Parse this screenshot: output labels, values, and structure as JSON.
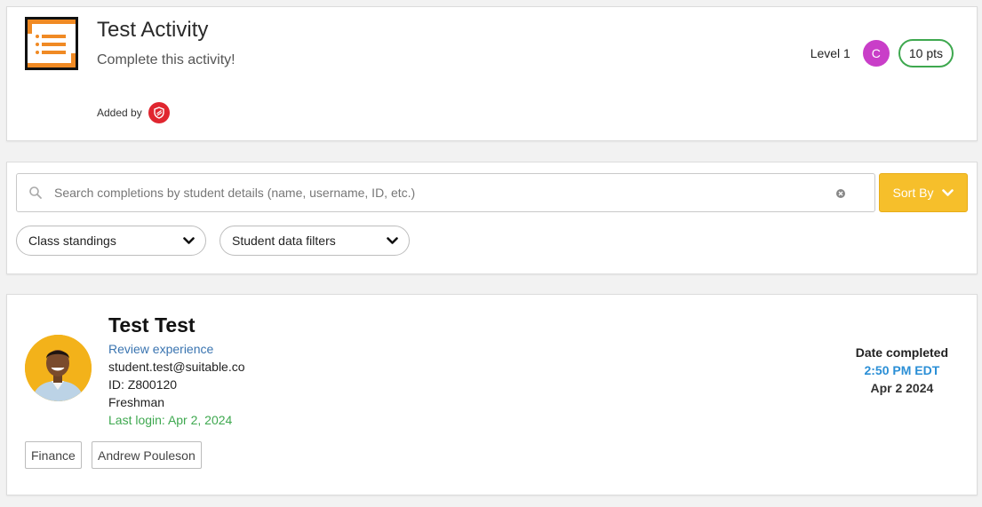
{
  "activity": {
    "title": "Test Activity",
    "subtitle": "Complete this activity!",
    "added_by_label": "Added by",
    "level_label": "Level 1",
    "level_avatar_letter": "C",
    "points": "10 pts",
    "colors": {
      "icon_accent": "#f08a24",
      "avatar": "#c93ec8",
      "points_border": "#3ea84f",
      "added_by_logo": "#e0262f"
    }
  },
  "search": {
    "placeholder": "Search completions by student details (name, username, ID, etc.)",
    "value": "",
    "sort_label": "Sort By",
    "sort_color": "#f6bf2b",
    "filters": [
      {
        "label": "Class standings"
      },
      {
        "label": "Student data filters"
      }
    ]
  },
  "completion": {
    "student_name": "Test Test",
    "review_link": "Review experience",
    "email": "student.test@suitable.co",
    "id_line": "ID: Z800120",
    "standing": "Freshman",
    "last_login": "Last login: Apr 2, 2024",
    "date_label": "Date completed",
    "date_time": "2:50 PM EDT",
    "date_day": "Apr 2 2024",
    "tags": [
      "Finance",
      "Andrew Pouleson"
    ]
  }
}
